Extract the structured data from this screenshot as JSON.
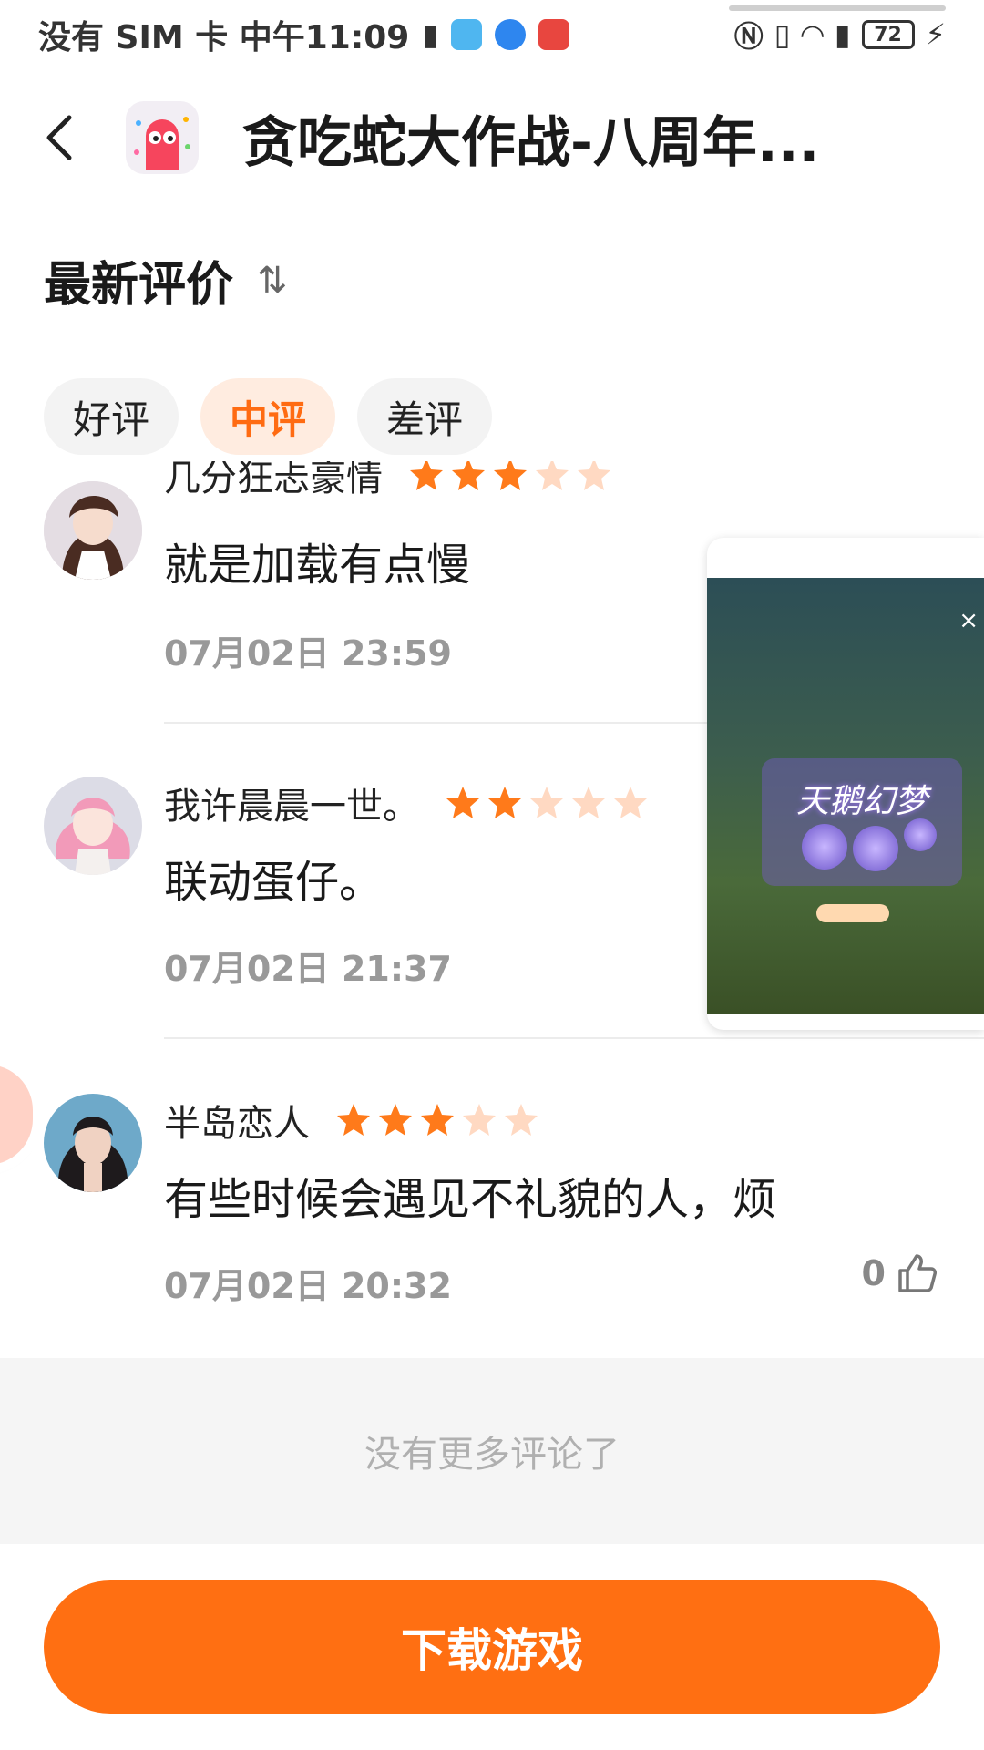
{
  "status_bar": {
    "left_text": "没有 SIM 卡 中午11:09",
    "battery": "72"
  },
  "header": {
    "title": "贪吃蛇大作战-八周年..."
  },
  "section": {
    "title": "最新评价"
  },
  "filters": [
    {
      "label": "好评",
      "active": false
    },
    {
      "label": "中评",
      "active": true
    },
    {
      "label": "差评",
      "active": false
    }
  ],
  "reviews": [
    {
      "name": "几分狂忐豪情",
      "rating": 3,
      "text": "就是加载有点慢",
      "time": "07月02日 23:59"
    },
    {
      "name": "我许晨晨一世。",
      "rating": 2,
      "text": "联动蛋仔。",
      "time": "07月02日 21:37"
    },
    {
      "name": "半岛恋人",
      "rating": 3,
      "text": "有些时候会遇见不礼貌的人，烦",
      "time": "07月02日 20:32",
      "likes": "0"
    }
  ],
  "float_video": {
    "title": "天鹅幻梦",
    "close": "×"
  },
  "footer": {
    "no_more": "没有更多评论了",
    "download_label": "下载游戏"
  },
  "colors": {
    "accent": "#ff6f12",
    "star_on": "#ff7a1a",
    "star_off": "#ffd9c2"
  }
}
